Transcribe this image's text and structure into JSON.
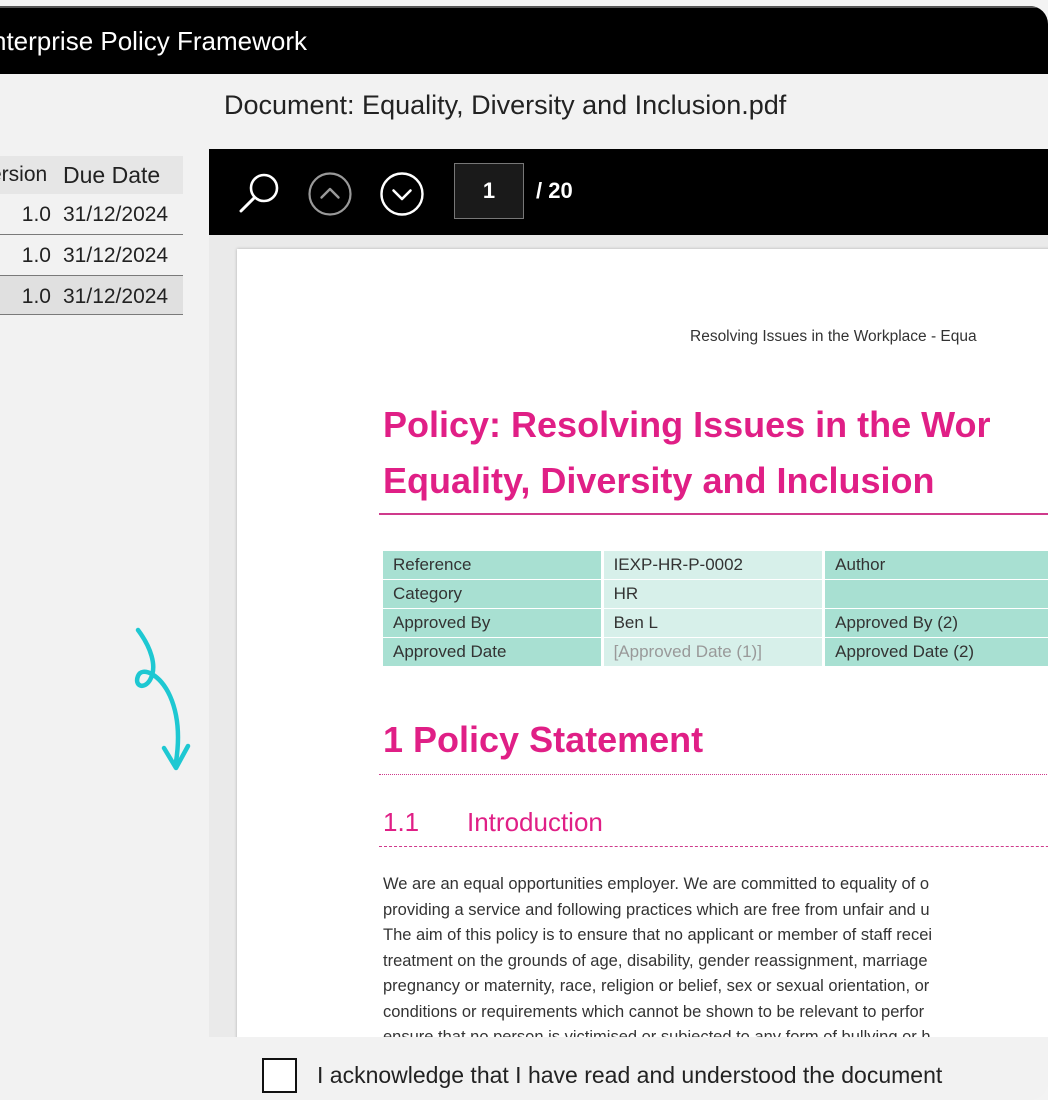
{
  "window": {
    "title": "nterprise Policy Framework"
  },
  "document": {
    "title": "Document: Equality, Diversity and Inclusion.pdf"
  },
  "left_table": {
    "headers": [
      "ersion",
      "Due Date"
    ],
    "rows": [
      {
        "version": "1.0",
        "due_date": "31/12/2024"
      },
      {
        "version": "1.0",
        "due_date": "31/12/2024"
      },
      {
        "version": "1.0",
        "due_date": "31/12/2024"
      }
    ]
  },
  "viewer": {
    "current_page": "1",
    "total_pages": "/ 20",
    "icons": [
      "search-icon",
      "chevron-up-icon",
      "chevron-down-icon"
    ]
  },
  "page": {
    "running_header": "Resolving Issues in the Workplace - Equa",
    "title_line1": "Policy: Resolving Issues in the Wor",
    "title_line2": "Equality, Diversity and Inclusion",
    "meta": {
      "reference_label": "Reference",
      "reference_value": "IEXP-HR-P-0002",
      "author_label": "Author",
      "category_label": "Category",
      "category_value": "HR",
      "approved_by_label": "Approved By",
      "approved_by_value": "Ben L",
      "approved_by_2_label": "Approved By (2)",
      "approved_date_label": "Approved Date",
      "approved_date_value": "[Approved Date (1)]",
      "approved_date_2_label": "Approved Date (2)"
    },
    "h1": "1  Policy Statement",
    "h2_number": "1.1",
    "h2_text": "Introduction",
    "body_lines": [
      "We are an equal opportunities employer. We are committed to equality of o",
      "providing a service and following practices which are free from unfair and u",
      "The aim of this policy is to ensure that no applicant or member of staff recei",
      "treatment on the grounds of age, disability, gender reassignment, marriage",
      "pregnancy or maternity, race, religion or belief, sex or sexual orientation, or",
      "conditions or requirements which cannot be shown to be relevant to perfor",
      "ensure that no person is victimised or subjected to any form of bullying or h"
    ]
  },
  "acknowledge": {
    "label": "I acknowledge that I have read and understood the document"
  },
  "colors": {
    "accent_pink": "#e01f86",
    "teal_cell": "#a8e0d2",
    "teal_light": "#d7f0ea",
    "doodle_cyan": "#1ec8d2"
  }
}
